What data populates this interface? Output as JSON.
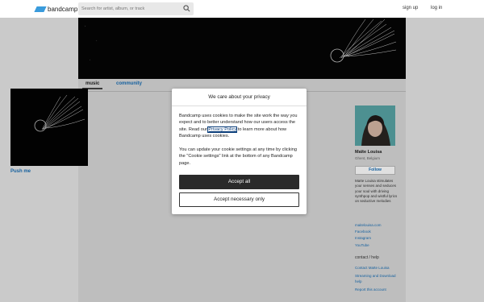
{
  "brand": {
    "name": "bandcamp",
    "accent": "#3a9bdc"
  },
  "search": {
    "placeholder": "Search for artist, album, or track"
  },
  "header": {
    "signup": "sign up",
    "login": "log in"
  },
  "tabs": {
    "music": "music",
    "community": "community"
  },
  "albums": [
    {
      "title": "Push me"
    }
  ],
  "artist": {
    "name": "Maïte Louisa",
    "location": "Ghent, Belgium",
    "follow_label": "Follow",
    "bio": "Maïte Louisa stimulates your senses and seduces your soul with driving synthpop and wistful lyrics on seductive melodies",
    "links": [
      "maitelouisa.com",
      "Facebook",
      "Instagram",
      "YouTube"
    ]
  },
  "contact": {
    "heading": "contact / help",
    "links": [
      "Contact Maïte Louisa",
      "Streaming and Download help",
      "Report this account"
    ]
  },
  "modal": {
    "title": "We care about your privacy",
    "p1_before": "Bandcamp uses cookies to make the site work the way you expect and to better understand how our users access the site. Read our ",
    "p1_link": "Privacy Policy",
    "p1_after": " to learn more about how Bandcamp uses cookies.",
    "p2": "You can update your cookie settings at any time by clicking the \"Cookie settings\" link at the bottom of any Bandcamp page.",
    "accept_all": "Accept all",
    "accept_necessary": "Accept necessary only"
  }
}
